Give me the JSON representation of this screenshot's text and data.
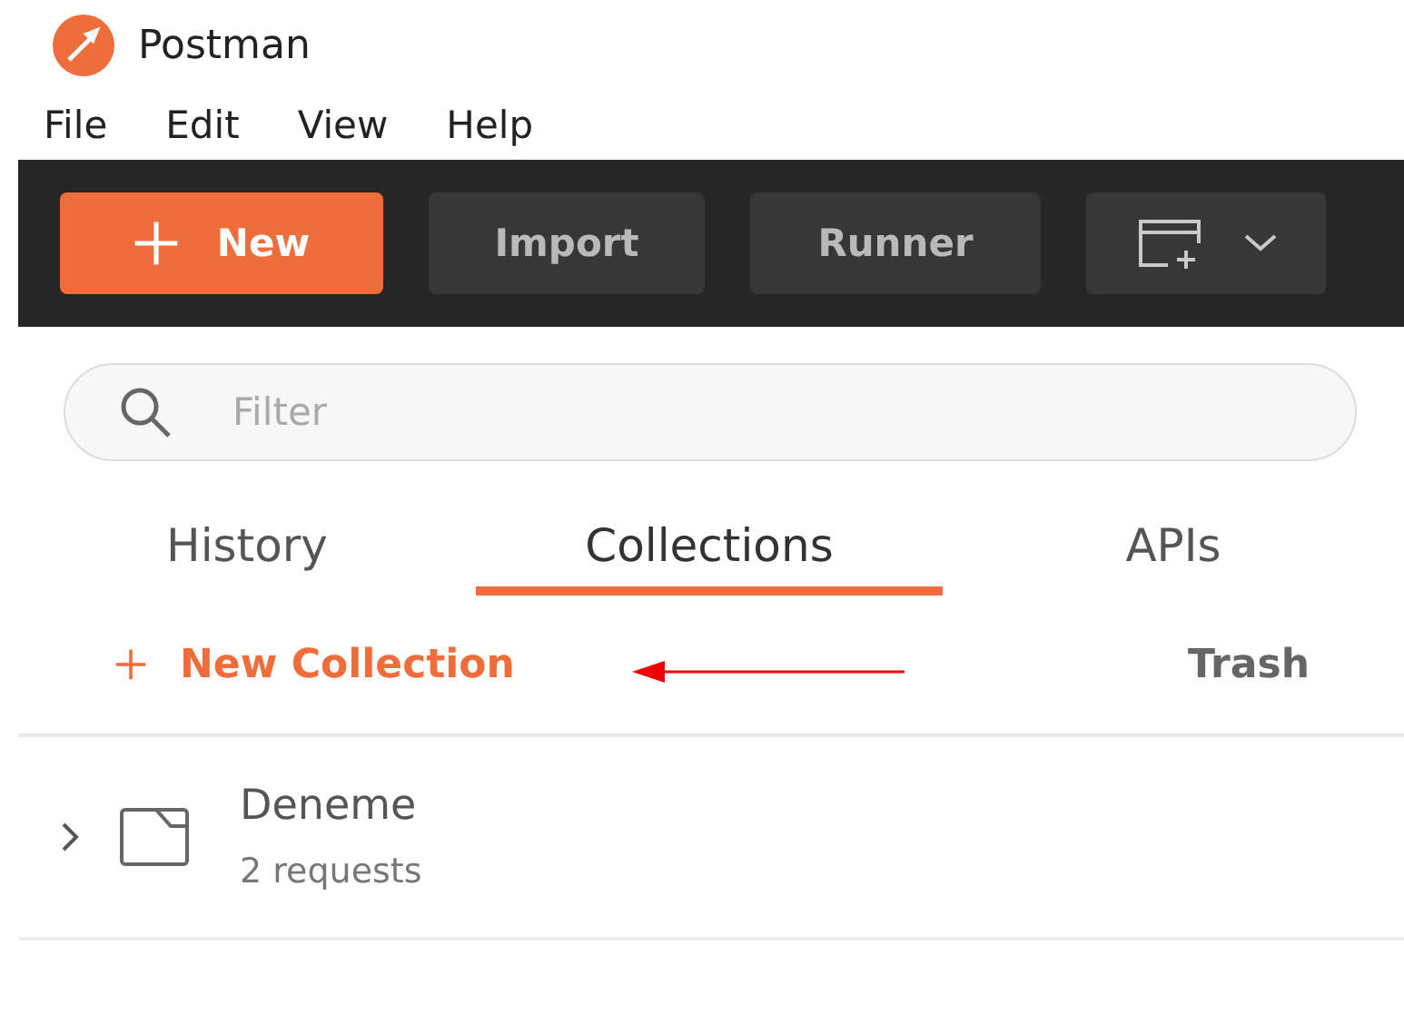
{
  "window": {
    "title": "Postman"
  },
  "menu": [
    "File",
    "Edit",
    "View",
    "Help"
  ],
  "toolbar": {
    "new_button": "New",
    "import_button": "Import",
    "runner_button": "Runner"
  },
  "search": {
    "placeholder": "Filter"
  },
  "tabs": [
    {
      "label": "History",
      "selected": false
    },
    {
      "label": "Collections",
      "selected": true
    },
    {
      "label": "APIs",
      "selected": false
    }
  ],
  "actions": {
    "new_collection": "New Collection",
    "trash": "Trash"
  },
  "collections": [
    {
      "name": "Deneme",
      "count": "2 requests",
      "expanded": false
    }
  ]
}
